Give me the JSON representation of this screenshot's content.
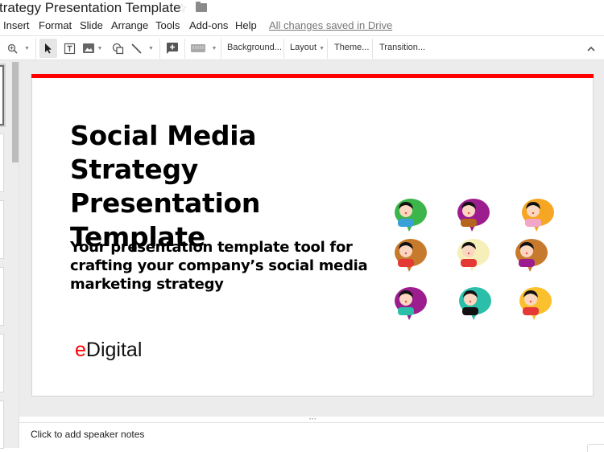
{
  "app": {
    "doc_title": "trategy Presentation Template",
    "save_status": "All changes saved in Drive"
  },
  "icons": {
    "star": "star-icon",
    "folder": "folder-icon",
    "zoom": "zoom-in-icon",
    "select": "cursor-select-icon",
    "textbox": "text-box-icon",
    "image": "image-icon",
    "shape": "shape-icon",
    "line": "line-icon",
    "comment": "add-comment-icon",
    "input_tools": "keyboard-icon",
    "collapse": "chevron-up-icon"
  },
  "menu": {
    "items": [
      "Insert",
      "Format",
      "Slide",
      "Arrange",
      "Tools",
      "Add-ons",
      "Help"
    ]
  },
  "toolbar": {
    "background_label": "Background...",
    "layout_label": "Layout",
    "theme_label": "Theme...",
    "transition_label": "Transition..."
  },
  "slide": {
    "accent_color": "#ff0000",
    "title": "Social Media Strategy Presentation Template",
    "subtitle": "Your presentation template tool for crafting your company’s social media marketing strategy",
    "brand_e": "e",
    "brand_rest": "Digital",
    "avatar_colors": [
      "#3cb54a",
      "#9b1d8e",
      "#f5a623",
      "#c87a2c",
      "#f7efb9",
      "#c87a2c",
      "#9b1d8e",
      "#2bbfaa",
      "#fbc02d"
    ]
  },
  "notes": {
    "placeholder": "Click to add speaker notes"
  }
}
